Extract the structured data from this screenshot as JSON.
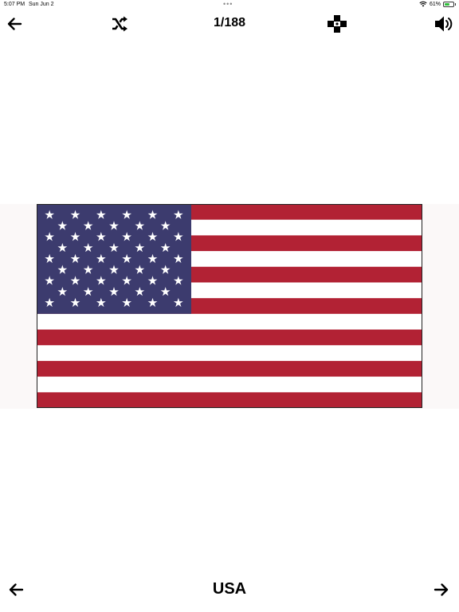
{
  "status_bar": {
    "time": "5:07 PM",
    "date": "Sun Jun 2",
    "multitask_dots": "•••",
    "battery_text": "61%",
    "battery_level": 0.61
  },
  "toolbar": {
    "counter": "1/188",
    "icons": [
      "back-arrow-icon",
      "shuffle-icon",
      "gamepad-icon",
      "speaker-icon"
    ]
  },
  "flag": {
    "country": "USA",
    "colors": {
      "red": "#b22234",
      "white": "#ffffff",
      "blue": "#3c3b6e"
    },
    "stripes": 13,
    "stars": 50
  },
  "bottom_nav": {
    "country_name": "USA",
    "icons": [
      "previous-arrow-icon",
      "next-arrow-icon"
    ]
  }
}
